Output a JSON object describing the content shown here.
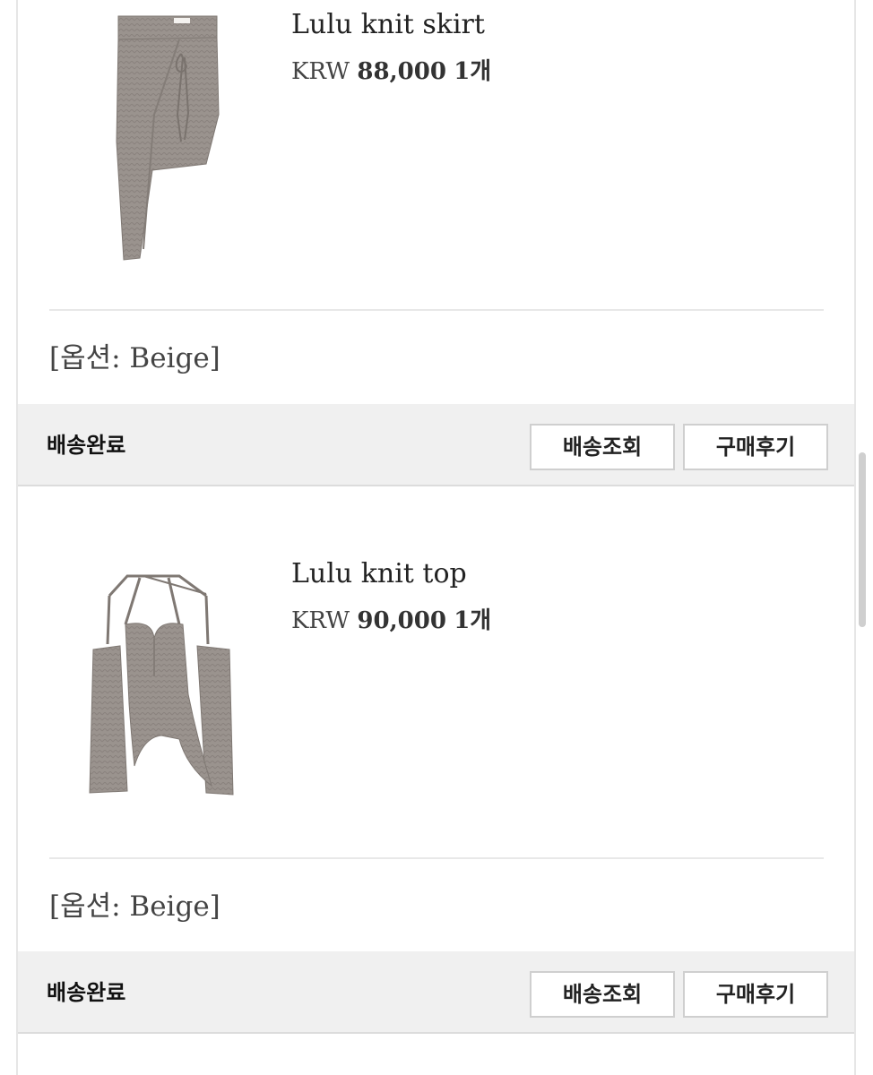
{
  "orders": [
    {
      "product_name": "Lulu knit skirt",
      "image_alt": "Lulu knit skirt product image",
      "currency": "KRW",
      "amount": "88,000",
      "quantity": "1개",
      "option": "[옵션: Beige]",
      "status": "배송완료",
      "track_label": "배송조회",
      "review_label": "구매후기"
    },
    {
      "product_name": "Lulu knit top",
      "image_alt": "Lulu knit top product image",
      "currency": "KRW",
      "amount": "90,000",
      "quantity": "1개",
      "option": "[옵션: Beige]",
      "status": "배송완료",
      "track_label": "배송조회",
      "review_label": "구매후기"
    }
  ],
  "colors": {
    "product_knit": "#9a938e",
    "status_bar_bg": "#f0f0f0"
  }
}
